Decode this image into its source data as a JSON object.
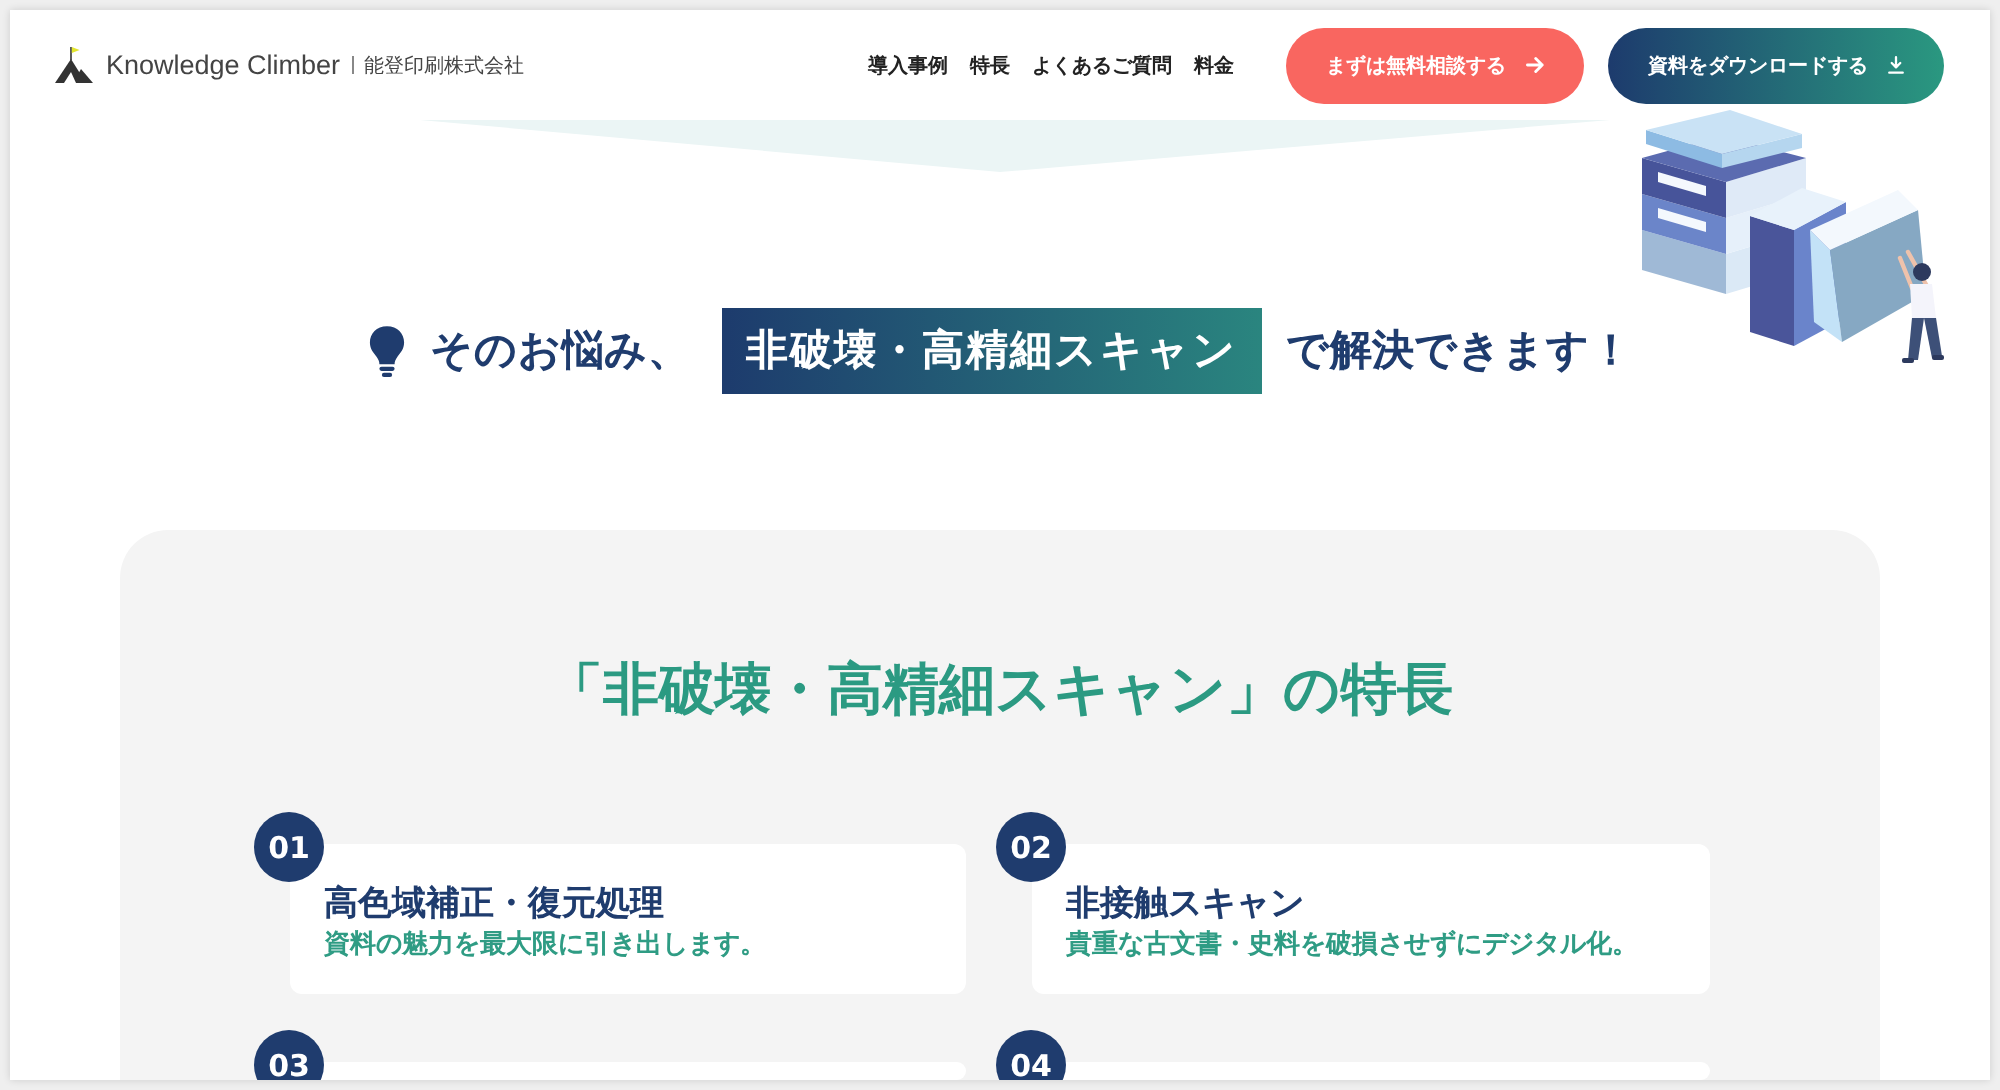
{
  "header": {
    "logo": {
      "wordmark": "Knowledge Climber",
      "company": "能登印刷株式会社"
    },
    "nav": [
      {
        "label": "導入事例"
      },
      {
        "label": "特長"
      },
      {
        "label": "よくあるご質問"
      },
      {
        "label": "料金"
      }
    ],
    "buttons": [
      {
        "label": "まずは無料相談する",
        "kind": "consult"
      },
      {
        "label": "資料をダウンロードする",
        "kind": "download"
      }
    ]
  },
  "hero": {
    "headline": {
      "before": "そのお悩み、",
      "highlight": "非破壊・高精細スキャン",
      "after": "で解決できます！"
    }
  },
  "features": {
    "title": "「非破壊・高精細スキャン」の特長",
    "items": [
      {
        "number": "01",
        "title": "高色域補正・復元処理",
        "description": "資料の魅力を最大限に引き出します。"
      },
      {
        "number": "02",
        "title": "非接触スキャン",
        "description": "貴重な古文書・史料を破損させずにデジタル化。"
      },
      {
        "number": "03"
      },
      {
        "number": "04"
      }
    ]
  }
}
